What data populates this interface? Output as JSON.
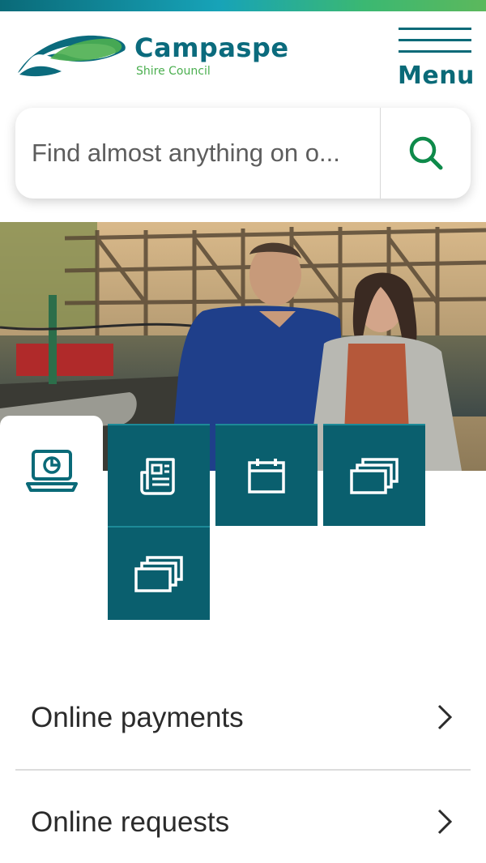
{
  "header": {
    "logo_title": "Campaspe",
    "logo_subtitle": "Shire Council",
    "menu_label": "Menu"
  },
  "search": {
    "placeholder": "Find almost anything on o..."
  },
  "quick_tiles": [
    {
      "icon": "laptop-chart-icon",
      "active": true
    },
    {
      "icon": "newspaper-icon",
      "active": false
    },
    {
      "icon": "calendar-icon",
      "active": false
    },
    {
      "icon": "stacked-pages-icon",
      "active": false
    },
    {
      "icon": "stacked-pages-icon",
      "active": false
    }
  ],
  "links": [
    {
      "label": "Online payments"
    },
    {
      "label": "Online requests"
    }
  ],
  "colors": {
    "brand_teal": "#0a6a78",
    "brand_green": "#4caf50",
    "tile_bg": "#0a5f6e"
  }
}
